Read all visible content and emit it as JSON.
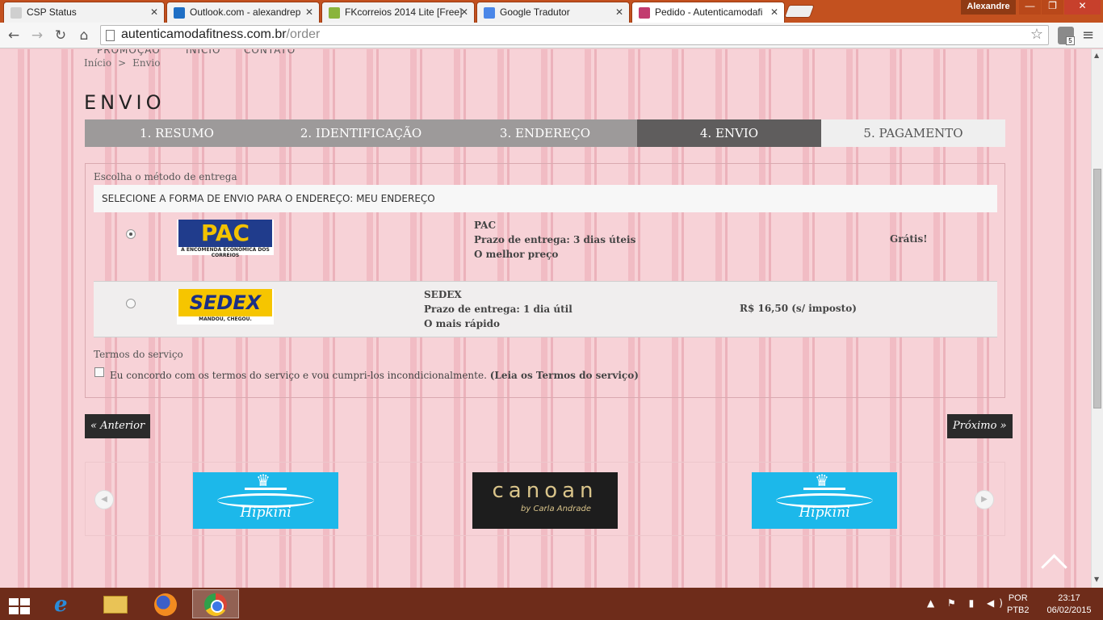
{
  "browser": {
    "tabs": [
      {
        "title": "CSP Status",
        "favicon_color": "#cfcfcf",
        "active": false
      },
      {
        "title": "Outlook.com - alexandrep",
        "favicon_color": "#1f6fc5",
        "active": false
      },
      {
        "title": "FKcorreios 2014 Lite [Free]",
        "favicon_color": "#8ab43c",
        "active": false
      },
      {
        "title": "Google Tradutor",
        "favicon_color": "#4b87e8",
        "active": false
      },
      {
        "title": "Pedido - Autenticamodafi",
        "favicon_color": "#c23b6f",
        "active": true
      }
    ],
    "user": "Alexandre",
    "url_host": "autenticamodafitness.com.br",
    "url_path": "/order"
  },
  "page": {
    "topnav": [
      "PROMOÇÃO",
      "INÍCIO",
      "CONTATO"
    ],
    "breadcrumb": {
      "home": "Início",
      "separator": ">",
      "current": "Envio"
    },
    "title": "ENVIO",
    "steps": [
      {
        "label": "1. RESUMO",
        "state": "done"
      },
      {
        "label": "2. IDENTIFICAÇÃO",
        "state": "done"
      },
      {
        "label": "3. ENDEREÇO",
        "state": "done"
      },
      {
        "label": "4. ENVIO",
        "state": "active"
      },
      {
        "label": "5. PAGAMENTO",
        "state": "todo"
      }
    ],
    "shipping": {
      "legend": "Escolha o método de entrega",
      "address_header": "SELECIONE A FORMA DE ENVIO PARA O ENDEREÇO: MEU ENDEREÇO",
      "options": [
        {
          "logo_word": "PAC",
          "logo_tagline": "A ENCOMENDA ECONÔMICA DOS CORREIOS",
          "name": "PAC",
          "delivery": "Prazo de entrega: 3 dias úteis",
          "note": "O melhor preço",
          "price": "Grátis!",
          "selected": true
        },
        {
          "logo_word": "SEDEX",
          "logo_tagline": "MANDOU, CHEGOU.",
          "name": "SEDEX",
          "delivery": "Prazo de entrega: 1 dia útil",
          "note": "O mais rápido",
          "price": "R$ 16,50 (s/ imposto)",
          "selected": false
        }
      ]
    },
    "terms": {
      "title": "Termos do serviço",
      "agree_text": "Eu concordo com os termos do serviço e vou cumpri-los incondicionalmente.",
      "link_text": "(Leia os Termos do serviço)",
      "checked": false
    },
    "buttons": {
      "previous": "« Anterior",
      "next": "Próximo »"
    },
    "brands": {
      "hipkini_script": "Hipkini",
      "canoan_name": "canoan",
      "canoan_by": "by Carla Andrade"
    }
  },
  "taskbar": {
    "language": "POR",
    "keyboard": "PTB2",
    "time": "23:17",
    "date": "06/02/2015"
  },
  "colors": {
    "tabbar": "#c3511f",
    "step_done": "#9d9a9a",
    "step_active": "#5f5d5d",
    "step_todo": "#efefef",
    "pac_blue": "#203c8c",
    "sedex_yellow": "#f6c500",
    "hipkini_blue": "#1cb8ea"
  }
}
